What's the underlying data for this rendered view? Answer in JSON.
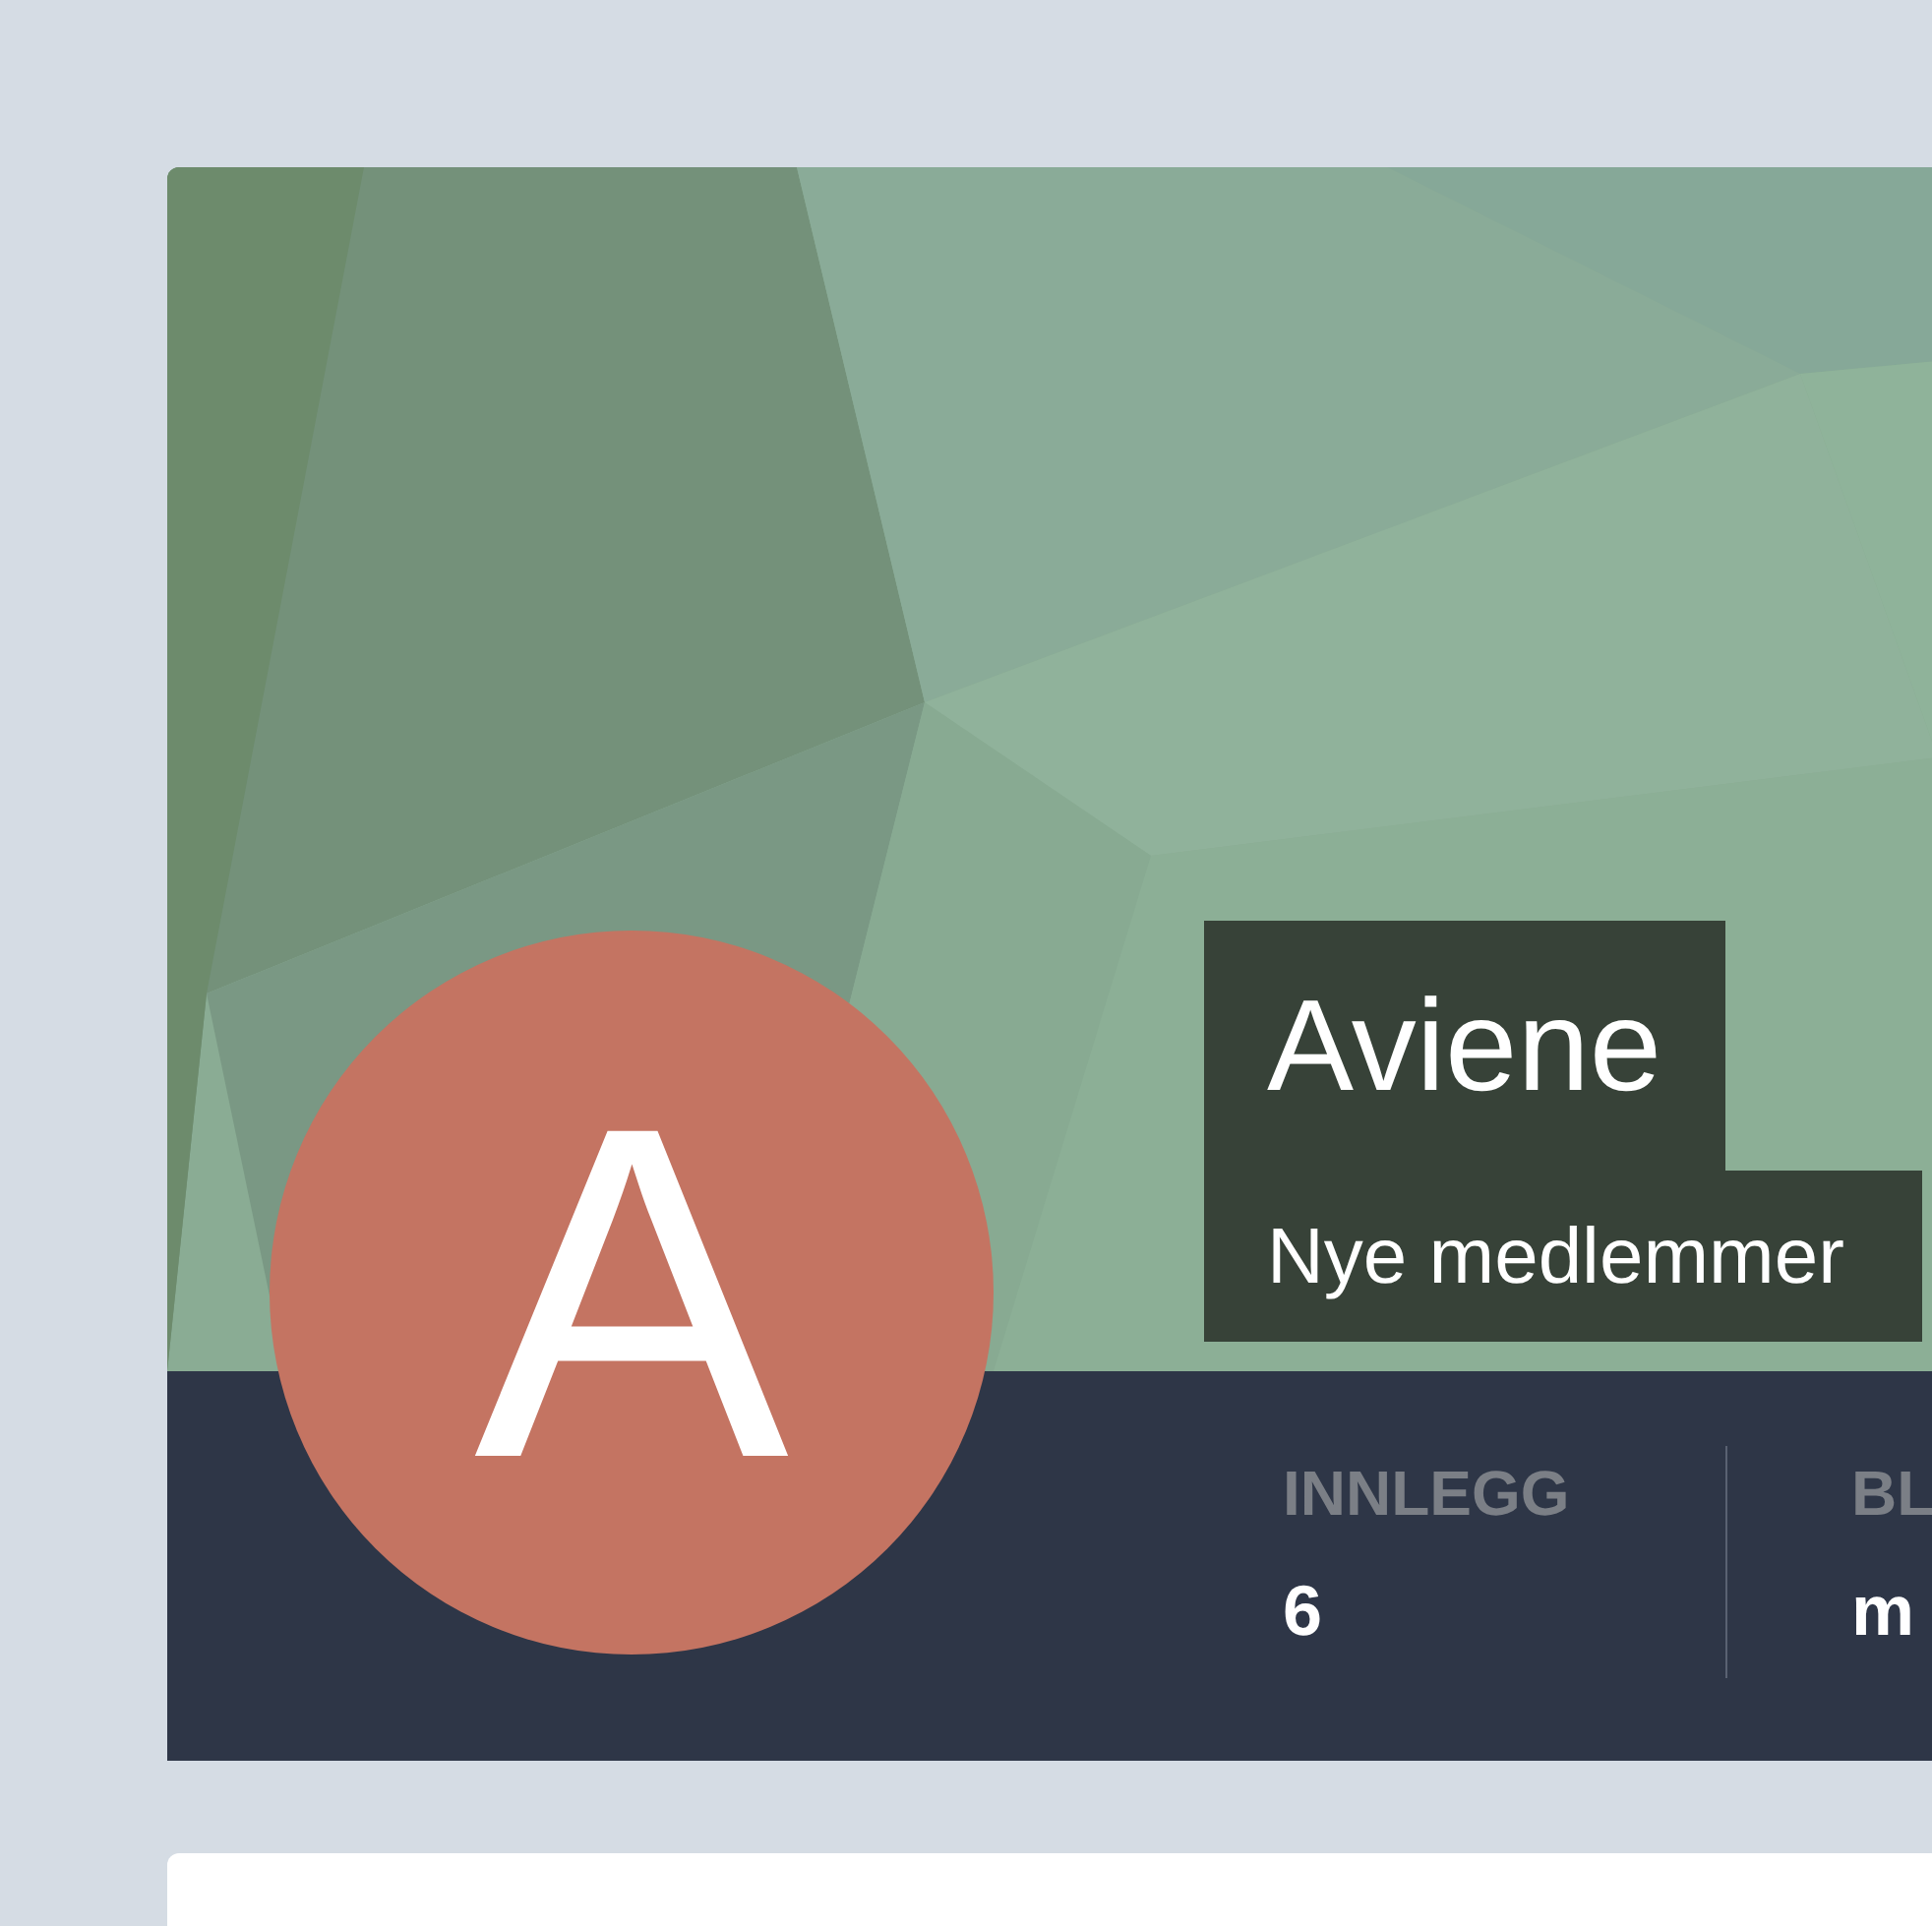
{
  "profile": {
    "initial": "A",
    "name": "Aviene",
    "tagline": "Nye medlemmer"
  },
  "stats": [
    {
      "label": "INNLEGG",
      "value": "6"
    },
    {
      "label": "BL",
      "value": "m"
    }
  ]
}
